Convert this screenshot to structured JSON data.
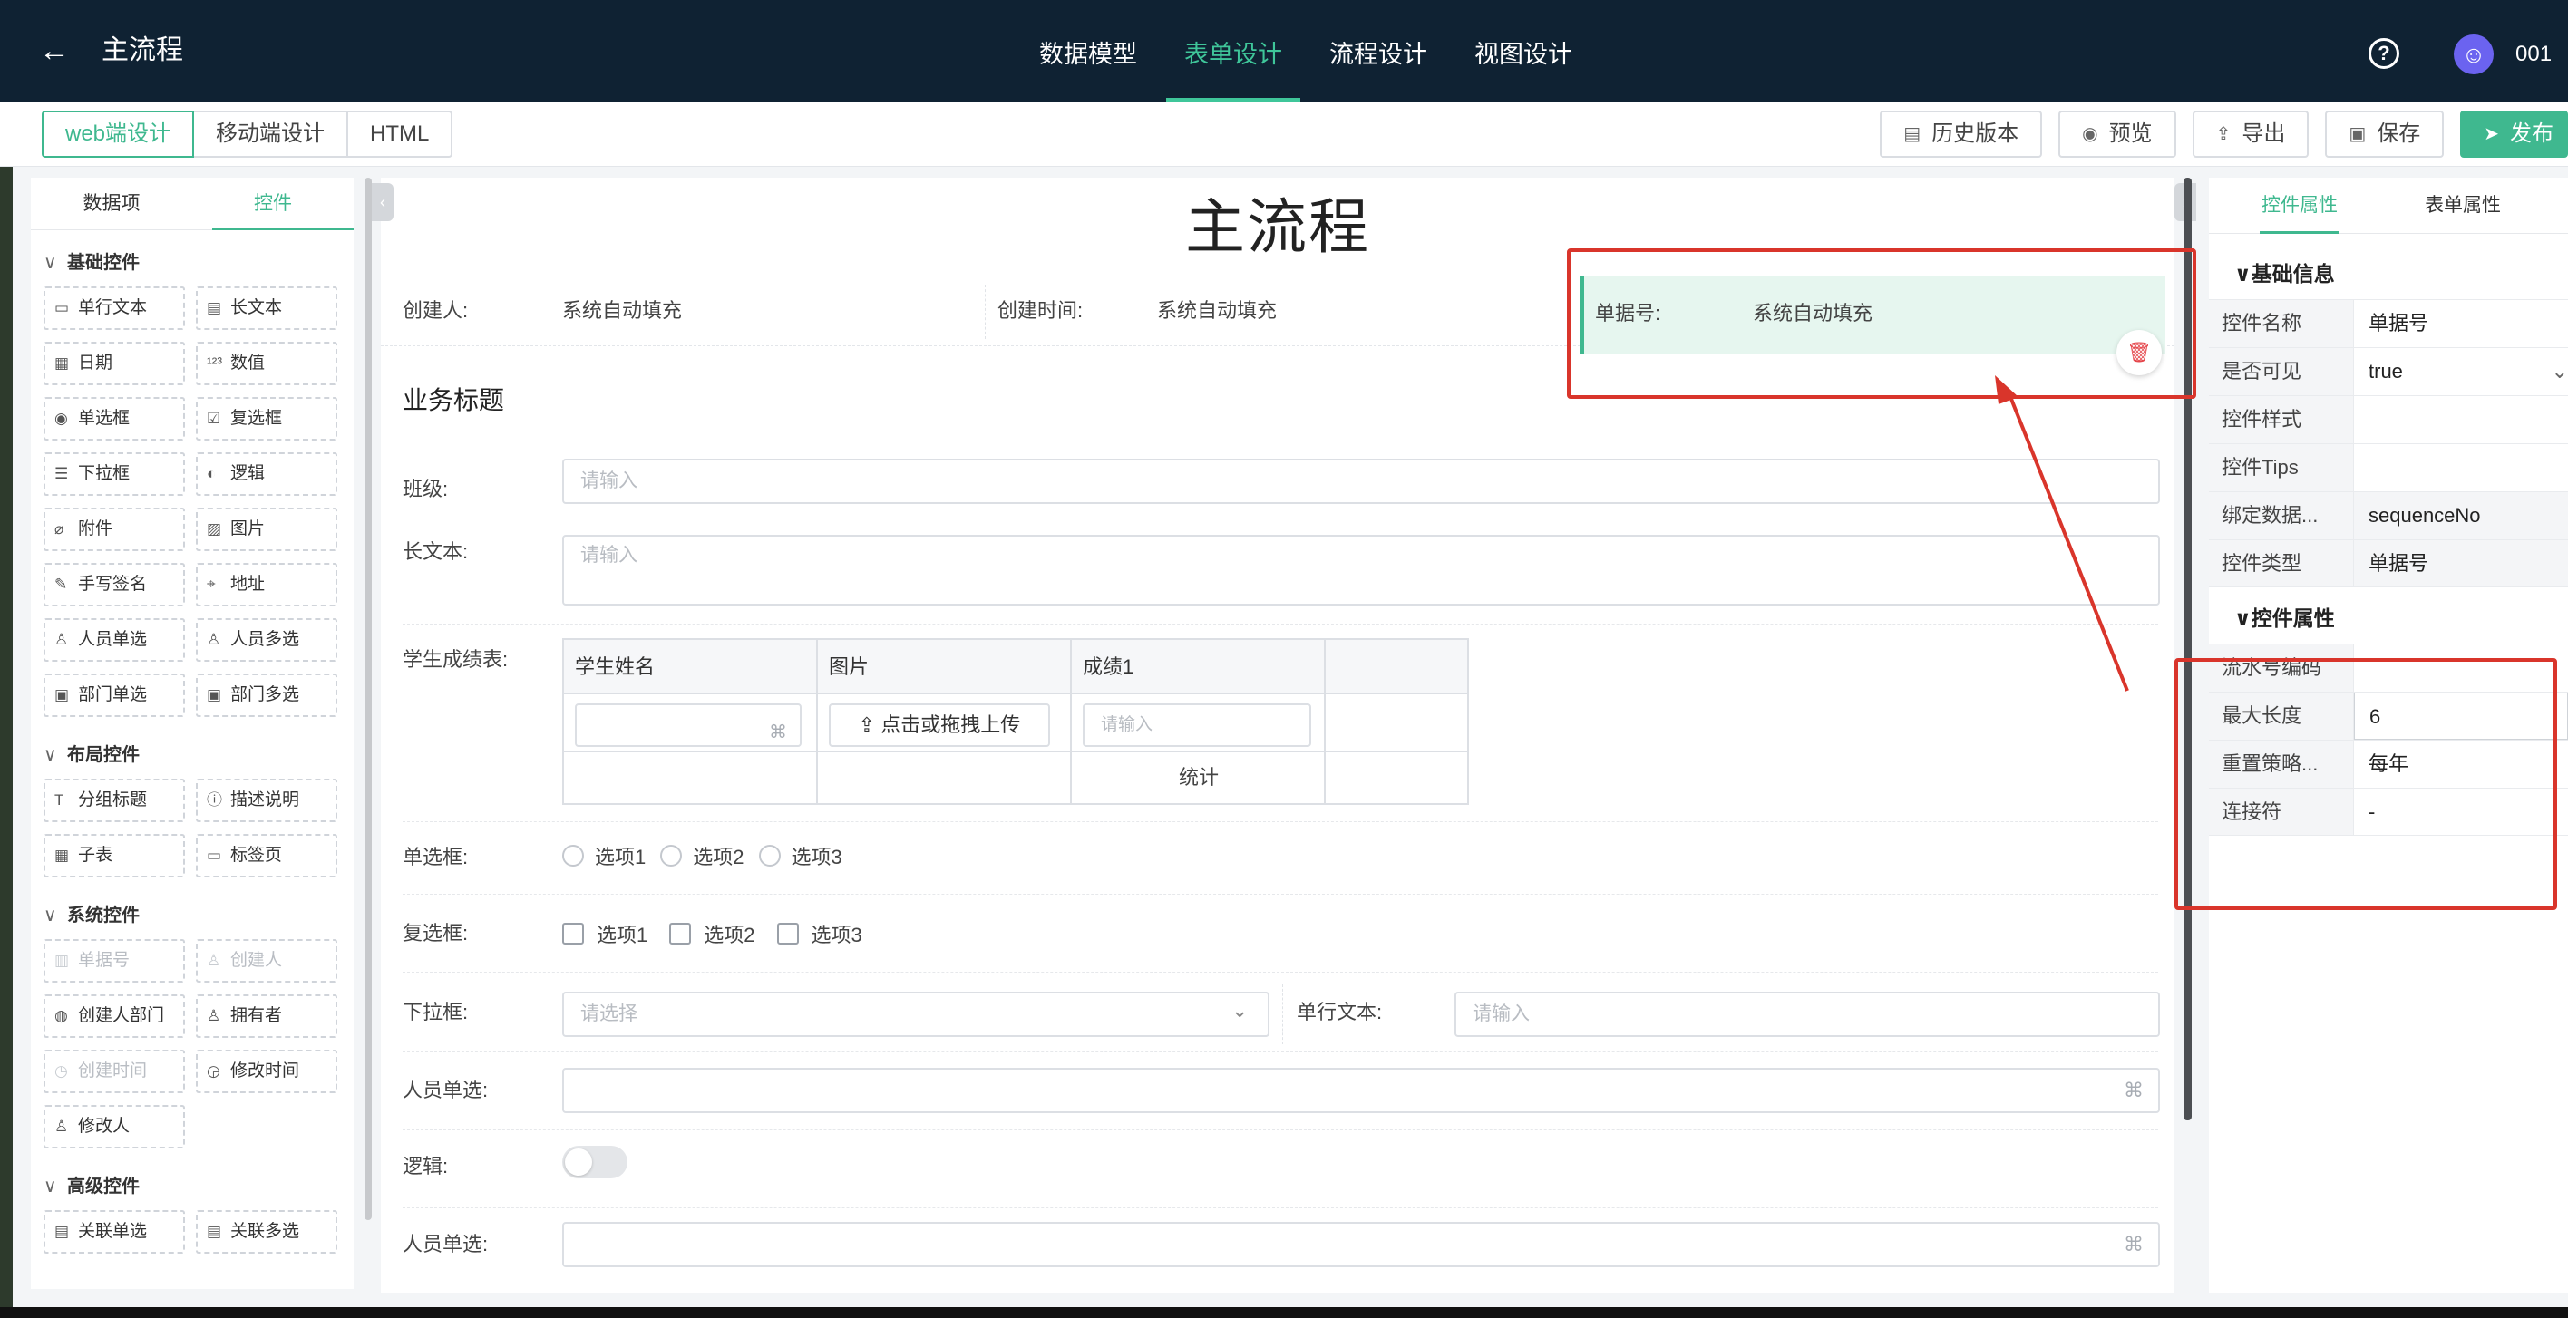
{
  "header": {
    "back_icon": "arrow-left-icon",
    "title": "主流程",
    "nav": [
      "数据模型",
      "表单设计",
      "流程设计",
      "视图设计"
    ],
    "active_nav": "表单设计",
    "help_icon": "question-circle-icon",
    "user_name": "001",
    "accent": "#3fc69a",
    "bg": "#0f2233"
  },
  "toolbar": {
    "mode_tabs": [
      "web端设计",
      "移动端设计",
      "HTML"
    ],
    "actions": {
      "history": "历史版本",
      "preview": "预览",
      "export": "导出",
      "save": "保存",
      "publish": "发布"
    }
  },
  "left_panel": {
    "tabs": [
      "数据项",
      "控件"
    ],
    "sections": {
      "basic": {
        "title": "基础控件",
        "items": [
          "单行文本",
          "长文本",
          "日期",
          "数值",
          "单选框",
          "复选框",
          "下拉框",
          "逻辑",
          "附件",
          "图片",
          "手写签名",
          "地址",
          "人员单选",
          "人员多选",
          "部门单选",
          "部门多选"
        ]
      },
      "layout": {
        "title": "布局控件",
        "items": [
          "分组标题",
          "描述说明",
          "子表",
          "标签页"
        ]
      },
      "system": {
        "title": "系统控件",
        "items": [
          "单据号",
          "创建人",
          "创建人部门",
          "拥有者",
          "创建时间",
          "修改时间",
          "修改人"
        ]
      },
      "advanced": {
        "title": "高级控件",
        "items": [
          "关联单选",
          "关联多选"
        ]
      }
    }
  },
  "form": {
    "title": "主流程",
    "system_fields": {
      "creator_label": "创建人:",
      "creator_value": "系统自动填充",
      "created_time_label": "创建时间:",
      "created_time_value": "系统自动填充",
      "seq_label": "单据号:",
      "seq_value": "系统自动填充"
    },
    "section_title": "业务标题",
    "fields": {
      "class_label": "班级:",
      "class_placeholder": "请输入",
      "longtext_label": "长文本:",
      "longtext_placeholder": "请输入",
      "subtable_label": "学生成绩表:",
      "radio_label": "单选框:",
      "checkbox_label": "复选框:",
      "dropdown_label": "下拉框:",
      "dropdown_placeholder": "请选择",
      "single_text_label": "单行文本:",
      "single_text_placeholder": "请输入",
      "person1_label": "人员单选:",
      "logic_label": "逻辑:",
      "person2_label": "人员单选:"
    },
    "subtable": {
      "columns": [
        "学生姓名",
        "图片",
        "成绩1"
      ],
      "upload_label": "点击或拖拽上传",
      "score_placeholder": "请输入",
      "summary": "统计"
    },
    "radio_options": [
      "选项1",
      "选项2",
      "选项3"
    ],
    "checkbox_options": [
      "选项1",
      "选项2",
      "选项3"
    ]
  },
  "right_panel": {
    "tabs": [
      "控件属性",
      "表单属性"
    ],
    "basic_section": "基础信息",
    "basic_rows": [
      {
        "key": "控件名称",
        "value": "单据号"
      },
      {
        "key": "是否可见",
        "value": "true"
      },
      {
        "key": "控件样式",
        "value": ""
      },
      {
        "key": "控件Tips",
        "value": ""
      },
      {
        "key": "绑定数据...",
        "value": "sequenceNo"
      },
      {
        "key": "控件类型",
        "value": "单据号"
      }
    ],
    "control_section": "控件属性",
    "control_rows": [
      {
        "key": "流水号编码",
        "value": ""
      },
      {
        "key": "最大长度",
        "value": "6"
      },
      {
        "key": "重置策略...",
        "value": "每年"
      },
      {
        "key": "连接符",
        "value": "-"
      }
    ]
  },
  "colors": {
    "primary": "#3fb88f",
    "annotation": "#d9352b",
    "delete": "#e5484d"
  }
}
